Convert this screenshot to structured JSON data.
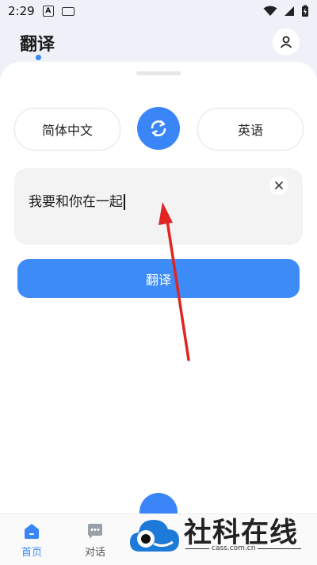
{
  "status_bar": {
    "time": "2:29",
    "icons": [
      "a-notification-icon",
      "keyboard-icon",
      "wifi-icon",
      "signal-icon",
      "battery-charging-icon"
    ]
  },
  "header": {
    "title": "翻译",
    "user_icon": "user-icon"
  },
  "languages": {
    "source": "简体中文",
    "target": "英语",
    "swap_icon": "swap-icon"
  },
  "input": {
    "value": "我要和你在一起",
    "clear_icon": "close-icon"
  },
  "translate_button": {
    "label": "翻译"
  },
  "bottom_nav": {
    "items": [
      {
        "label": "首页",
        "icon": "home-icon",
        "active": true
      },
      {
        "label": "对话",
        "icon": "chat-icon",
        "active": false
      }
    ]
  },
  "watermark": {
    "brand": "社科在线",
    "url": "cass.com.cn"
  },
  "colors": {
    "accent": "#3a86f8",
    "annotation": "#e02424"
  }
}
